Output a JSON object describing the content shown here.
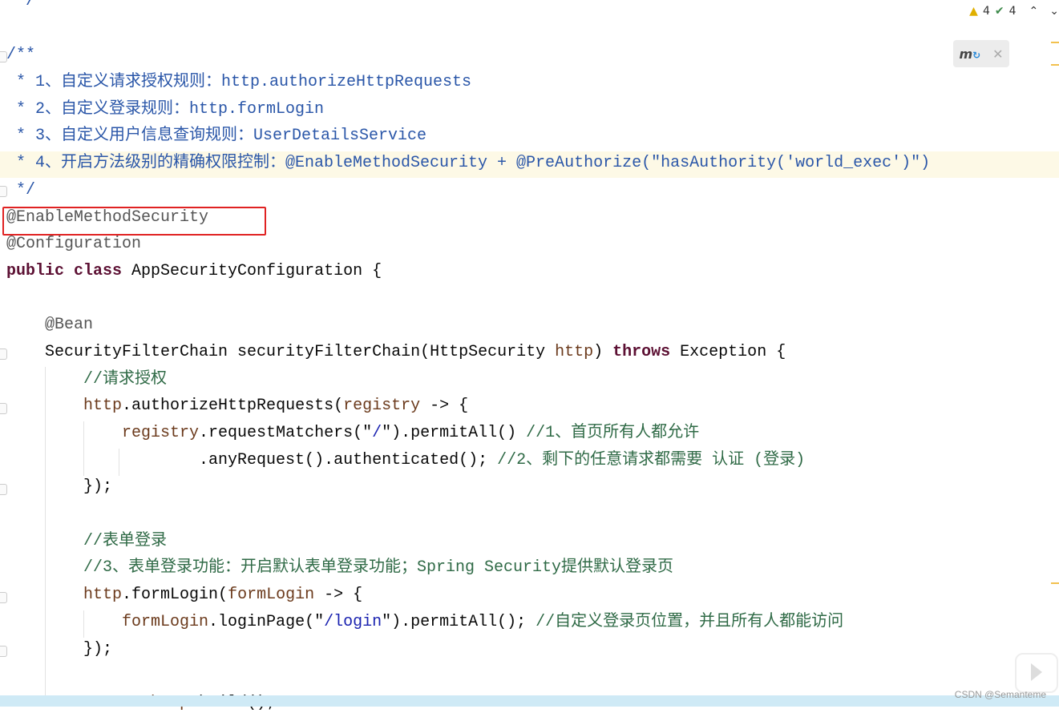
{
  "status": {
    "warnings": "4",
    "checks": "4",
    "warning_icon": "warning-triangle-icon",
    "check_icon": "double-check-icon"
  },
  "watermark": "CSDN @Semanteme",
  "colors": {
    "doc": "#2a56a8",
    "comment": "#2f6a46",
    "keyword": "#5c1033",
    "highlight_box": "#e02222"
  },
  "lines": [
    [
      {
        "t": " */",
        "c": "doc"
      }
    ],
    [],
    [
      {
        "t": "/**",
        "c": "doc"
      }
    ],
    [
      {
        "t": " * 1、自定义请求授权规则：http.authorizeHttpRequests",
        "c": "doc"
      }
    ],
    [
      {
        "t": " * 2、自定义登录规则：http.formLogin",
        "c": "doc"
      }
    ],
    [
      {
        "t": " * 3、自定义用户信息查询规则：UserDetailsService",
        "c": "doc"
      }
    ],
    [
      {
        "t": " * 4、开启方法级别的精确权限控制：@EnableMethodSecurity + @PreAuthorize(\"hasAuthority('world_exec')\")",
        "c": "doc"
      }
    ],
    [
      {
        "t": " */",
        "c": "doc"
      }
    ],
    [
      {
        "t": "@EnableMethodSecurity",
        "c": "ann"
      }
    ],
    [
      {
        "t": "@Configuration",
        "c": "ann"
      }
    ],
    [
      {
        "t": "public class ",
        "c": "kw"
      },
      {
        "t": "AppSecurityConfiguration {",
        "c": "fn"
      }
    ],
    [],
    [
      {
        "t": "    @Bean",
        "c": "ann"
      }
    ],
    [
      {
        "t": "    SecurityFilterChain securityFilterChain(HttpSecurity ",
        "c": "fn"
      },
      {
        "t": "http",
        "c": "par"
      },
      {
        "t": ") ",
        "c": "fn"
      },
      {
        "t": "throws ",
        "c": "kw"
      },
      {
        "t": "Exception {",
        "c": "fn"
      }
    ],
    [
      {
        "t": "        //请求授权",
        "c": "cm"
      }
    ],
    [
      {
        "t": "        http",
        "c": "par"
      },
      {
        "t": ".authorizeHttpRequests(",
        "c": "fn"
      },
      {
        "t": "registry",
        "c": "par"
      },
      {
        "t": " -> {",
        "c": "fn"
      }
    ],
    [
      {
        "t": "            registry",
        "c": "par"
      },
      {
        "t": ".requestMatchers(\"",
        "c": "fn"
      },
      {
        "t": "/",
        "c": "str"
      },
      {
        "t": "\").permitAll() ",
        "c": "fn"
      },
      {
        "t": "//1、首页所有人都允许",
        "c": "cm"
      }
    ],
    [
      {
        "t": "                    .anyRequest().authenticated(); ",
        "c": "fn"
      },
      {
        "t": "//2、剩下的任意请求都需要 认证 (登录)",
        "c": "cm"
      }
    ],
    [
      {
        "t": "        });",
        "c": "fn"
      }
    ],
    [],
    [
      {
        "t": "        //表单登录",
        "c": "cm"
      }
    ],
    [
      {
        "t": "        //3、表单登录功能：开启默认表单登录功能；Spring Security提供默认登录页",
        "c": "cm"
      }
    ],
    [
      {
        "t": "        http",
        "c": "par"
      },
      {
        "t": ".formLogin(",
        "c": "fn"
      },
      {
        "t": "formLogin",
        "c": "par"
      },
      {
        "t": " -> {",
        "c": "fn"
      }
    ],
    [
      {
        "t": "            formLogin",
        "c": "par"
      },
      {
        "t": ".loginPage(\"",
        "c": "fn"
      },
      {
        "t": "/login",
        "c": "str"
      },
      {
        "t": "\").permitAll(); ",
        "c": "fn"
      },
      {
        "t": "//自定义登录页位置，并且所有人都能访问",
        "c": "cm"
      }
    ],
    [
      {
        "t": "        });",
        "c": "fn"
      }
    ],
    [],
    [
      {
        "t": "        return ",
        "c": "kw"
      },
      {
        "t": "http",
        "c": "par"
      },
      {
        "t": ".build();",
        "c": "fn"
      }
    ]
  ]
}
